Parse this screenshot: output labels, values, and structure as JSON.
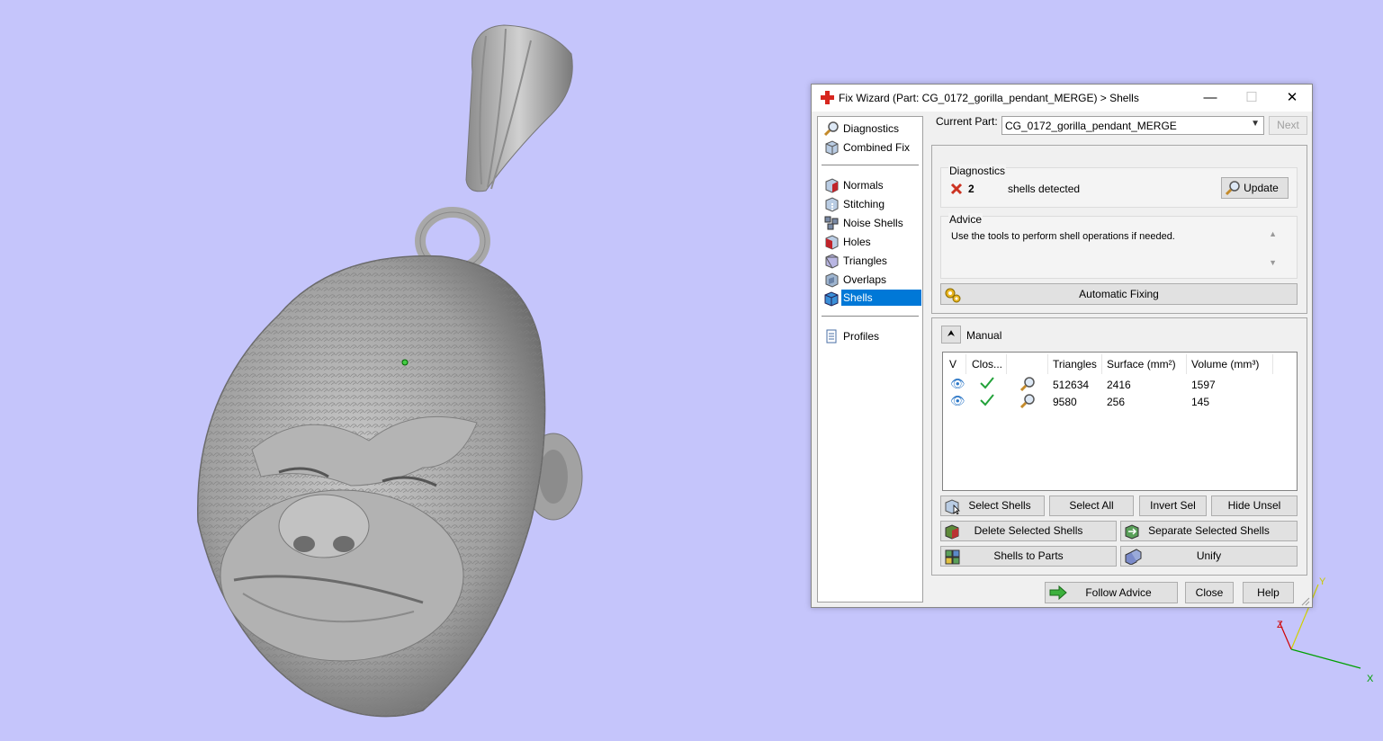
{
  "window": {
    "title": "Fix Wizard (Part: CG_0172_gorilla_pendant_MERGE) > Shells",
    "minimize": "—",
    "maximize": "☐",
    "close": "✕"
  },
  "nav": {
    "group1": [
      {
        "label": "Diagnostics",
        "icon": "magnifier-icon"
      },
      {
        "label": "Combined Fix",
        "icon": "cube-icon"
      }
    ],
    "group2": [
      {
        "label": "Normals",
        "icon": "normals-cube-icon"
      },
      {
        "label": "Stitching",
        "icon": "stitching-cube-icon"
      },
      {
        "label": "Noise Shells",
        "icon": "noise-shells-icon"
      },
      {
        "label": "Holes",
        "icon": "holes-cube-icon"
      },
      {
        "label": "Triangles",
        "icon": "triangles-cube-icon"
      },
      {
        "label": "Overlaps",
        "icon": "overlaps-cube-icon"
      },
      {
        "label": "Shells",
        "icon": "shells-cube-icon",
        "selected": true
      }
    ],
    "group3": [
      {
        "label": "Profiles",
        "icon": "document-icon"
      }
    ]
  },
  "current_part": {
    "label": "Current Part:",
    "value": "CG_0172_gorilla_pendant_MERGE",
    "next": "Next"
  },
  "diagnostics": {
    "heading": "Diagnostics",
    "count": "2",
    "text": "shells detected",
    "update": "Update"
  },
  "advice": {
    "heading": "Advice",
    "text": "Use the tools to perform shell operations if needed."
  },
  "automatic_fixing": "Automatic Fixing",
  "manual": {
    "label": "Manual",
    "columns": [
      "V",
      "Clos...",
      "",
      "Triangles",
      "Surface (mm²)",
      "Volume (mm³)"
    ],
    "rows": [
      {
        "triangles": "512634",
        "surface": "2416",
        "volume": "1597"
      },
      {
        "triangles": "9580",
        "surface": "256",
        "volume": "145"
      }
    ],
    "buttons": {
      "select_shells": "Select Shells",
      "select_all": "Select All",
      "invert_sel": "Invert Sel",
      "hide_unsel": "Hide Unsel",
      "delete_selected": "Delete Selected Shells",
      "separate_selected": "Separate Selected Shells",
      "shells_to_parts": "Shells to Parts",
      "unify": "Unify"
    }
  },
  "footer": {
    "follow_advice": "Follow Advice",
    "close": "Close",
    "help": "Help"
  },
  "axes": {
    "x": "X",
    "y": "Y",
    "z": "Z"
  },
  "colors": {
    "viewport_bg": "#c5c5fb",
    "selection": "#0078d7",
    "model": "#a9a9a9"
  }
}
